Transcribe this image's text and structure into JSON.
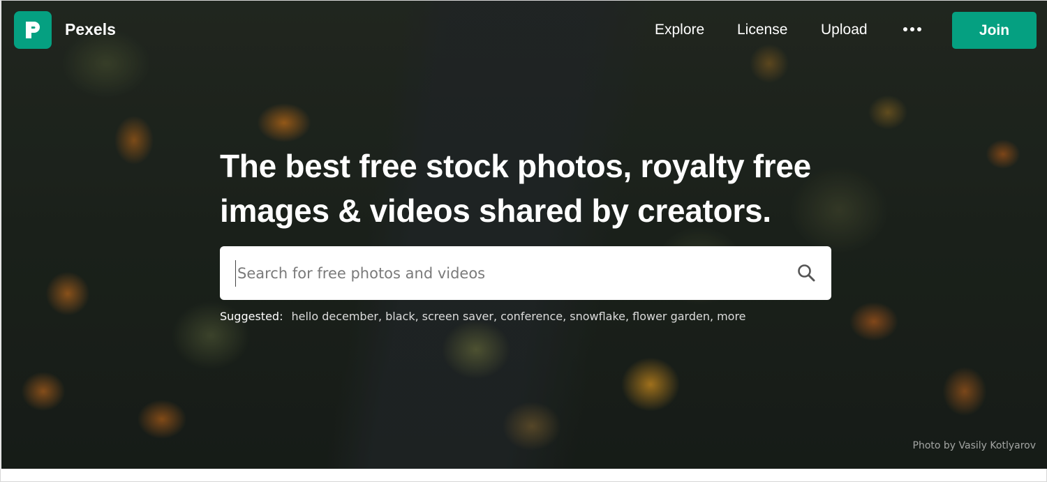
{
  "brand": {
    "name": "Pexels",
    "logo_icon": "pexels-logo-icon",
    "color": "#05a081"
  },
  "nav": {
    "links": [
      "Explore",
      "License",
      "Upload"
    ],
    "more_icon": "more-dots-icon",
    "join_label": "Join"
  },
  "hero": {
    "headline_line1": "The best free stock photos, royalty free",
    "headline_line2": "images & videos shared by creators.",
    "search_placeholder": "Search for free photos and videos",
    "search_icon": "search-icon",
    "suggested_label": "Suggested:",
    "suggestions": [
      "hello december",
      "black",
      "screen saver",
      "conference",
      "snowflake",
      "flower garden",
      "more"
    ],
    "photo_credit": "Photo by Vasily Kotlyarov"
  }
}
